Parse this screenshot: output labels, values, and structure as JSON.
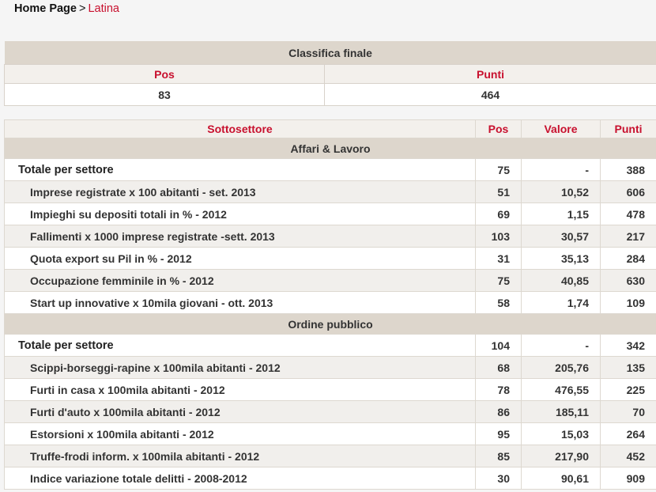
{
  "breadcrumb": {
    "home": "Home Page",
    "separator": ">",
    "current": "Latina"
  },
  "summary": {
    "title": "Classifica finale",
    "col_pos": "Pos",
    "col_punti": "Punti",
    "pos": "83",
    "punti": "464"
  },
  "detail": {
    "headers": {
      "sottosettore": "Sottosettore",
      "pos": "Pos",
      "valore": "Valore",
      "punti": "Punti"
    },
    "sections": [
      {
        "title": "Affari & Lavoro",
        "total": {
          "name": "Totale per settore",
          "pos": "75",
          "valore": "-",
          "punti": "388"
        },
        "rows": [
          {
            "name": "Imprese registrate x 100 abitanti - set. 2013",
            "pos": "51",
            "valore": "10,52",
            "punti": "606"
          },
          {
            "name": "Impieghi su depositi totali in % - 2012",
            "pos": "69",
            "valore": "1,15",
            "punti": "478"
          },
          {
            "name": "Fallimenti x 1000 imprese registrate -sett. 2013",
            "pos": "103",
            "valore": "30,57",
            "punti": "217"
          },
          {
            "name": "Quota export su Pil in % - 2012",
            "pos": "31",
            "valore": "35,13",
            "punti": "284"
          },
          {
            "name": "Occupazione femminile in % - 2012",
            "pos": "75",
            "valore": "40,85",
            "punti": "630"
          },
          {
            "name": "Start up innovative x 10mila giovani - ott. 2013",
            "pos": "58",
            "valore": "1,74",
            "punti": "109"
          }
        ]
      },
      {
        "title": "Ordine pubblico",
        "total": {
          "name": "Totale per settore",
          "pos": "104",
          "valore": "-",
          "punti": "342"
        },
        "rows": [
          {
            "name": "Scippi-borseggi-rapine x 100mila abitanti - 2012",
            "pos": "68",
            "valore": "205,76",
            "punti": "135"
          },
          {
            "name": "Furti in casa x 100mila abitanti - 2012",
            "pos": "78",
            "valore": "476,55",
            "punti": "225"
          },
          {
            "name": "Furti d'auto x 100mila abitanti - 2012",
            "pos": "86",
            "valore": "185,11",
            "punti": "70"
          },
          {
            "name": "Estorsioni x 100mila abitanti - 2012",
            "pos": "95",
            "valore": "15,03",
            "punti": "264"
          },
          {
            "name": "Truffe-frodi inform. x 100mila abitanti - 2012",
            "pos": "85",
            "valore": "217,90",
            "punti": "452"
          },
          {
            "name": "Indice variazione totale delitti - 2008-2012",
            "pos": "30",
            "valore": "90,61",
            "punti": "909"
          }
        ]
      }
    ]
  }
}
